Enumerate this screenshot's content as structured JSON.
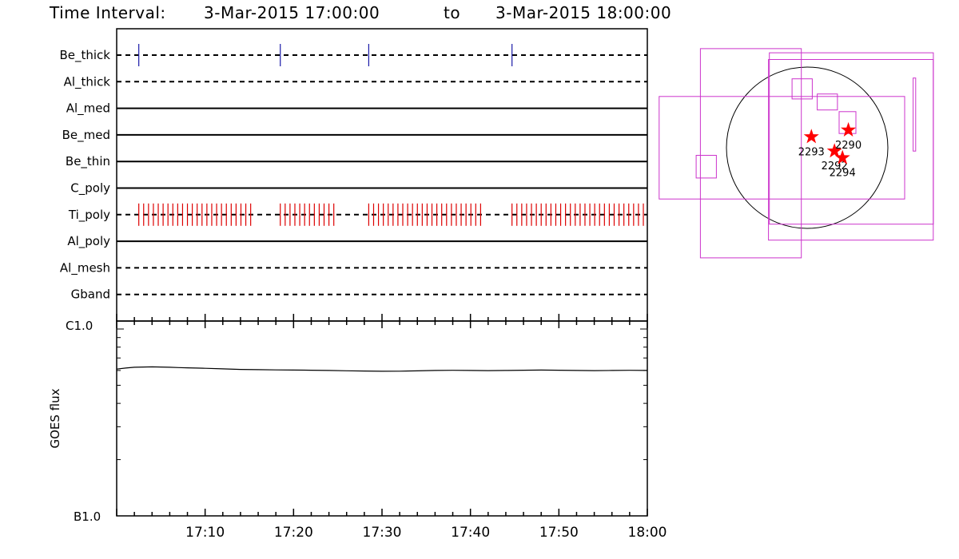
{
  "title": {
    "prefix": "Time Interval:",
    "start": "3-Mar-2015 17:00:00",
    "joiner": "to",
    "end": "3-Mar-2015 18:00:00"
  },
  "chart_data": [
    {
      "type": "timeline",
      "name": "filter-usage",
      "x_range_minutes": [
        0,
        60
      ],
      "rows": [
        {
          "label": "Be_thick",
          "style": "dashed",
          "ticks_color": "#1a1aa8",
          "ticks_minutes": [
            2.5,
            18.5,
            28.5,
            44.7
          ]
        },
        {
          "label": "Al_thick",
          "style": "dashed"
        },
        {
          "label": "Al_med",
          "style": "solid"
        },
        {
          "label": "Be_med",
          "style": "solid"
        },
        {
          "label": "Be_thin",
          "style": "solid"
        },
        {
          "label": "C_poly",
          "style": "solid"
        },
        {
          "label": "Ti_poly",
          "style": "dashed",
          "ticks_color": "#dd0000",
          "tick_spans_minutes": [
            [
              2.5,
              15.2
            ],
            [
              18.5,
              25.0
            ],
            [
              28.5,
              41.2
            ],
            [
              44.7,
              60.0
            ]
          ],
          "tick_step_minutes": 0.55
        },
        {
          "label": "Al_poly",
          "style": "solid"
        },
        {
          "label": "Al_mesh",
          "style": "dashed"
        },
        {
          "label": "Gband",
          "style": "dashed"
        }
      ]
    },
    {
      "type": "line",
      "name": "goes-flux",
      "ylabel": "GOES flux",
      "y_scale": "log",
      "ylim": [
        1e-07,
        1e-06
      ],
      "y_tick_labels": [
        {
          "value": 1e-06,
          "label": "C1.0"
        },
        {
          "value": 1e-07,
          "label": "B1.0"
        }
      ],
      "x_range_minutes": [
        0,
        60
      ],
      "x_tick_labels": [
        "17:10",
        "17:20",
        "17:30",
        "17:40",
        "17:50",
        "18:00"
      ],
      "x_tick_minutes": [
        10,
        20,
        30,
        40,
        50,
        60
      ],
      "series": [
        {
          "color": "#000000",
          "x_minutes": [
            0,
            1,
            2,
            3,
            4,
            5,
            6,
            7,
            8,
            9,
            10,
            12,
            14,
            16,
            18,
            20,
            22,
            24,
            26,
            28,
            30,
            32,
            34,
            36,
            38,
            40,
            42,
            44,
            46,
            48,
            50,
            52,
            54,
            56,
            58,
            60
          ],
          "flux": [
            6.1e-07,
            6.18e-07,
            6.24e-07,
            6.26e-07,
            6.27e-07,
            6.26e-07,
            6.24e-07,
            6.22e-07,
            6.2e-07,
            6.18e-07,
            6.16e-07,
            6.12e-07,
            6.08e-07,
            6.06e-07,
            6.04e-07,
            6.03e-07,
            6.02e-07,
            6e-07,
            5.98e-07,
            5.96e-07,
            5.94e-07,
            5.95e-07,
            5.97e-07,
            6e-07,
            6.01e-07,
            6e-07,
            5.99e-07,
            6e-07,
            6.02e-07,
            6.03e-07,
            6.02e-07,
            6e-07,
            5.99e-07,
            6e-07,
            6.01e-07,
            6e-07
          ]
        }
      ]
    },
    {
      "type": "scatter",
      "name": "solar-disk-map",
      "disk_radius_arcsec": 960,
      "boxes_arcsec": [
        [
          -1760,
          -610,
          1160,
          610
        ],
        [
          -450,
          -910,
          1500,
          1130
        ],
        [
          -460,
          -1100,
          1500,
          1050
        ],
        [
          -1270,
          -1310,
          -70,
          1180
        ],
        [
          -1320,
          -360,
          -1080,
          -90
        ],
        [
          -180,
          580,
          60,
          820
        ],
        [
          120,
          450,
          360,
          640
        ],
        [
          380,
          170,
          580,
          430
        ],
        [
          1260,
          830,
          1290,
          -40
        ]
      ],
      "regions": [
        {
          "label": "2290",
          "x": 490,
          "y": 210
        },
        {
          "label": "2293",
          "x": 50,
          "y": 130
        },
        {
          "label": "2292",
          "x": 325,
          "y": -40
        },
        {
          "label": "2294",
          "x": 420,
          "y": -120
        }
      ],
      "box_color": "#cc33cc",
      "marker_color": "#ff0000"
    }
  ]
}
